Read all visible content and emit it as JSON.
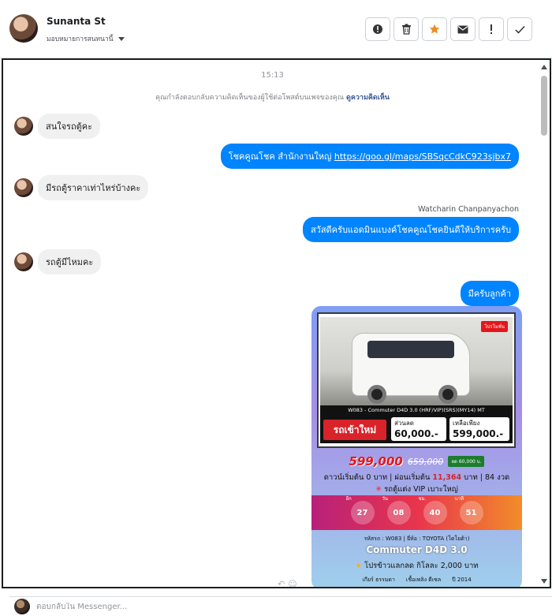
{
  "header": {
    "name": "Sunanta St",
    "assign_label": "มอบหมายการสนทนานี้",
    "actions": [
      {
        "name": "report-button",
        "icon": "alert-circle-icon"
      },
      {
        "name": "delete-button",
        "icon": "trash-icon"
      },
      {
        "name": "star-button",
        "icon": "star-icon"
      },
      {
        "name": "mark-unread-button",
        "icon": "envelope-icon"
      },
      {
        "name": "spam-button",
        "icon": "exclamation-icon"
      },
      {
        "name": "done-button",
        "icon": "check-icon"
      }
    ]
  },
  "chat": {
    "time": "15:13",
    "notice_text": "คุณกำลังตอบกลับความคิดเห็นของผู้ใช้ต่อโพสต์บนเพจของคุณ",
    "notice_link": "ดูความคิดเห็น",
    "messages": [
      {
        "dir": "in",
        "text": "สนใจรถตู้คะ"
      },
      {
        "dir": "out",
        "text": "โชคคูณโชค สำนักงานใหญ่",
        "link": "https://goo.gl/maps/SBSqcCdkC923sjbx7"
      },
      {
        "dir": "in",
        "text": "มีรถตู้ราคาเท่าไหร่บ้างคะ"
      },
      {
        "dir": "out",
        "sender": "Watcharin Chanpanyachon",
        "text": "สวัสดีครับแอดมินแบงค์โชคคูณโชคยินดีให้บริการครับ"
      },
      {
        "dir": "in",
        "text": "รถตู้มีไหมคะ"
      },
      {
        "dir": "out",
        "text": "มีครับลูกค้า"
      }
    ]
  },
  "card": {
    "promo_tag": "โปรโมชั่น",
    "model_strip": "W083 - Commuter D4D 3.0 (HRF/VIP)(SRS)(MY14) MT",
    "new_arrival": "รถเข้าใหม่",
    "discount_label": "ส่วนลด",
    "discount_value": "60,000.-",
    "remaining_label": "เหลือเพียง",
    "remaining_value": "599,000.-",
    "price": "599,000",
    "old_price": "659,000",
    "badge": "ลด 60,000 บ.",
    "finance_1": "ดาวน์เริ่มต้น 0 บาท | ผ่อนเริ่มต้น",
    "finance_amount": "11,364",
    "finance_2": "บาท | 84 งวด",
    "vip_line": "รถตู้แต่ง VIP เบาะใหญ่",
    "countdown": [
      {
        "label": "อีก",
        "value": "27"
      },
      {
        "label": "วัน",
        "value": "08"
      },
      {
        "label": "ชม.",
        "value": "40"
      },
      {
        "label": "นาที",
        "value": "51"
      }
    ],
    "info_small": "รหัสรถ : W083 | ยี่ห้อ : TOYOTA (โตโยต้า)",
    "model_name": "Commuter D4D 3.0",
    "gift_line": "โปรข้าวแลกลด กิโลละ 2,000 บาท",
    "footer_tags": [
      "เกียร์ ธรรมดา",
      "เชื้อเพลิง ดีเซล",
      "ปี 2014"
    ]
  },
  "reply": {
    "placeholder": "ตอบกลับใน Messenger..."
  }
}
